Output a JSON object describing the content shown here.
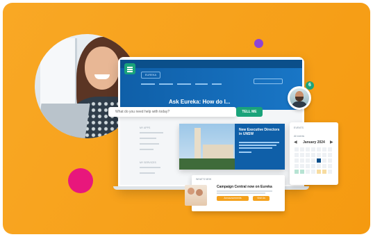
{
  "hero": {
    "title": "Ask Eureka: How do I...",
    "logo_text": "EUREKA"
  },
  "search": {
    "placeholder": "What do you need help with today?",
    "button_label": "TELL ME"
  },
  "sidebar": {
    "section1": "MY APPS",
    "section2": "MY SERVICES"
  },
  "news": {
    "title": "New Executive Directors in UNSW"
  },
  "calendar": {
    "header": "EVENTS",
    "subheader": "All events",
    "month": "January 2024",
    "prev": "◀",
    "next": "▶"
  },
  "whats_new": {
    "header": "WHAT'S NEW",
    "title": "Campaign Central now on Eureka",
    "button1": "Announcements",
    "button2": "Visit Us"
  },
  "notification": {
    "count": "6"
  },
  "colors": {
    "background": "#f7a21c",
    "brand_blue": "#0f5fa8",
    "accent_green": "#1aa37a",
    "accent_pink": "#e8177c",
    "accent_purple": "#8e44d6"
  }
}
